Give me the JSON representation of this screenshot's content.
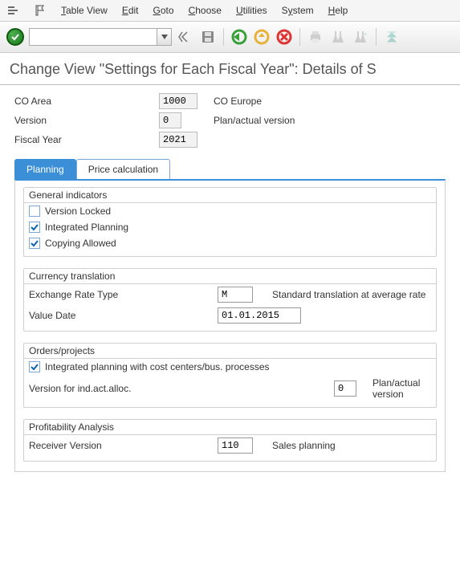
{
  "menu": {
    "items": [
      "Table View",
      "Edit",
      "Goto",
      "Choose",
      "Utilities",
      "System",
      "Help"
    ]
  },
  "page_title": "Change View \"Settings for Each Fiscal Year\": Details of S",
  "header": {
    "co_area_label": "CO Area",
    "co_area_value": "1000",
    "co_area_desc": "CO Europe",
    "version_label": "Version",
    "version_value": "0",
    "version_desc": "Plan/actual version",
    "fy_label": "Fiscal Year",
    "fy_value": "2021"
  },
  "tabs": {
    "planning": "Planning",
    "price_calc": "Price calculation"
  },
  "planning": {
    "gi_title": "General indicators",
    "version_locked": {
      "label": "Version Locked",
      "checked": false
    },
    "integrated_planning": {
      "label": "Integrated Planning",
      "checked": true
    },
    "copying_allowed": {
      "label": "Copying Allowed",
      "checked": true
    },
    "ct_title": "Currency translation",
    "exch_label": "Exchange Rate Type",
    "exch_value": "M",
    "exch_desc": "Standard translation at average rate",
    "valdate_label": "Value Date",
    "valdate_value": "01.01.2015",
    "op_title": "Orders/projects",
    "op_check": {
      "label": "Integrated planning with cost centers/bus. processes",
      "checked": true
    },
    "op_ver_label": "Version for ind.act.alloc.",
    "op_ver_value": "0",
    "op_ver_desc": "Plan/actual version",
    "pa_title": "Profitability Analysis",
    "pa_recv_label": "Receiver Version",
    "pa_recv_value": "110",
    "pa_recv_desc": "Sales planning"
  }
}
